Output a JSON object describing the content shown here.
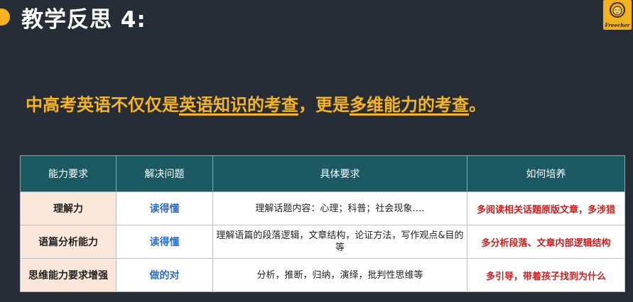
{
  "header": {
    "title": "教学反思 4:",
    "logo_text": "Freecher"
  },
  "statement": {
    "part1": "中高考英语不仅仅是",
    "highlight1": "英语知识的考查",
    "part2": "，更是",
    "highlight2": "多维能力的考查",
    "part3": "。"
  },
  "table": {
    "headers": [
      "能力要求",
      "解决问题",
      "具体要求",
      "如何培养"
    ],
    "rows": [
      {
        "ability": "理解力",
        "solve": "读得懂",
        "detail": "理解话题内容：心理；科普；社会现象….",
        "cultivate": "多阅读相关话题原版文章，多涉猎"
      },
      {
        "ability": "语篇分析能力",
        "solve": "读得懂",
        "detail": "理解语篇的段落逻辑，文章结构，论证方法，写作观点&目的等",
        "cultivate": "多分析段落、文章内部逻辑结构"
      },
      {
        "ability": "思维能力要求增强",
        "solve": "做的对",
        "detail": "分析，推断，归纳，演绎，批判性思维等",
        "cultivate": "多引导，带着孩子找到为什么"
      }
    ]
  },
  "colors": {
    "background": "#262d37",
    "accent": "#f6b51f",
    "header_bg": "#1b5963",
    "ability_bg": "#fbe7d9",
    "solve_text": "#2a6fc8",
    "cultivate_text": "#cc1f1f"
  }
}
